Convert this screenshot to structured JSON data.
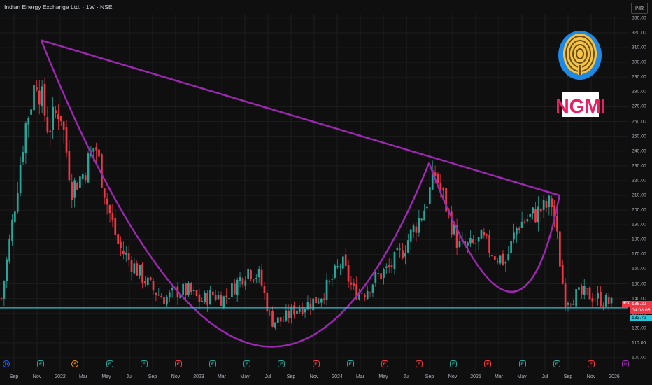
{
  "header": {
    "title": "Indian Energy Exchange Ltd. · 1W · NSE",
    "currency": "INR"
  },
  "price_labels": {
    "last_price": "136.22",
    "countdown": "04:08:05",
    "support": "133.72",
    "ticker": "IEX"
  },
  "logo": {
    "text": "NGMI"
  },
  "colors": {
    "background": "#0f0f0f",
    "up": "#26a69a",
    "down": "#f23645",
    "trendline": "#9c27b0",
    "support_line": "#26c6da"
  },
  "events": [
    {
      "type": "D",
      "x_label": "Sep"
    },
    {
      "type": "E",
      "x_label": "Nov"
    },
    {
      "type": "S",
      "x_label": "2022"
    },
    {
      "type": "E",
      "x_label": "Mar"
    },
    {
      "type": "E",
      "x_label": "May"
    },
    {
      "type": "Er",
      "x_label": "Jul"
    },
    {
      "type": "E",
      "x_label": "Sep"
    },
    {
      "type": "E",
      "x_label": "Nov"
    },
    {
      "type": "E",
      "x_label": "2023"
    },
    {
      "type": "Er",
      "x_label": "May"
    },
    {
      "type": "E",
      "x_label": "Sep"
    },
    {
      "type": "Er",
      "x_label": "2024"
    },
    {
      "type": "Er",
      "x_label": "May"
    },
    {
      "type": "E",
      "x_label": "Sep"
    },
    {
      "type": "Er",
      "x_label": "2025"
    },
    {
      "type": "E",
      "x_label": "May"
    },
    {
      "type": "E",
      "x_label": "Jul"
    },
    {
      "type": "Er",
      "x_label": "Nov"
    },
    {
      "type": "P",
      "x_label": "2026"
    }
  ],
  "chart_data": {
    "type": "candlestick",
    "title": "Indian Energy Exchange Ltd. · 1W · NSE",
    "ylabel": "INR",
    "ylim": [
      100,
      330
    ],
    "y_ticks": [
      100,
      110,
      120,
      130,
      140,
      150,
      160,
      170,
      180,
      190,
      200,
      210,
      220,
      230,
      240,
      250,
      260,
      270,
      280,
      290,
      300,
      310,
      320,
      330
    ],
    "x_ticks": [
      "Sep",
      "Nov",
      "2022",
      "Mar",
      "May",
      "Jul",
      "Sep",
      "Nov",
      "2023",
      "Mar",
      "May",
      "Jul",
      "Sep",
      "Nov",
      "2024",
      "Mar",
      "May",
      "Jul",
      "Sep",
      "Nov",
      "2025",
      "Mar",
      "May",
      "Jul",
      "Sep",
      "Nov",
      "2026"
    ],
    "close_path": [
      [
        "2021-08",
        140
      ],
      [
        "2021-09",
        195
      ],
      [
        "2021-10",
        255
      ],
      [
        "2021-11",
        290
      ],
      [
        "2021-12",
        255
      ],
      [
        "2022-01",
        270
      ],
      [
        "2022-02",
        215
      ],
      [
        "2022-03",
        225
      ],
      [
        "2022-04",
        245
      ],
      [
        "2022-05",
        205
      ],
      [
        "2022-06",
        175
      ],
      [
        "2022-07",
        165
      ],
      [
        "2022-08",
        155
      ],
      [
        "2022-09",
        145
      ],
      [
        "2022-10",
        140
      ],
      [
        "2022-11",
        145
      ],
      [
        "2022-12",
        145
      ],
      [
        "2023-01",
        138
      ],
      [
        "2023-02",
        143
      ],
      [
        "2023-03",
        140
      ],
      [
        "2023-04",
        150
      ],
      [
        "2023-05",
        160
      ],
      [
        "2023-06",
        155
      ],
      [
        "2023-07",
        125
      ],
      [
        "2023-08",
        125
      ],
      [
        "2023-09",
        133
      ],
      [
        "2023-10",
        136
      ],
      [
        "2023-11",
        140
      ],
      [
        "2023-12",
        150
      ],
      [
        "2024-01",
        165
      ],
      [
        "2024-02",
        145
      ],
      [
        "2024-03",
        145
      ],
      [
        "2024-04",
        155
      ],
      [
        "2024-05",
        160
      ],
      [
        "2024-06",
        170
      ],
      [
        "2024-07",
        185
      ],
      [
        "2024-08",
        200
      ],
      [
        "2024-09",
        225
      ],
      [
        "2024-10",
        200
      ],
      [
        "2024-11",
        175
      ],
      [
        "2024-12",
        175
      ],
      [
        "2025-01",
        180
      ],
      [
        "2025-02",
        170
      ],
      [
        "2025-03",
        165
      ],
      [
        "2025-04",
        190
      ],
      [
        "2025-05",
        195
      ],
      [
        "2025-06",
        200
      ],
      [
        "2025-07",
        205
      ],
      [
        "2025-08",
        140
      ],
      [
        "2025-09",
        142
      ],
      [
        "2025-10",
        143
      ],
      [
        "2025-11",
        140
      ],
      [
        "2025-12",
        136
      ]
    ],
    "drawings": {
      "descending_trendline": {
        "from": [
          "2021-09",
          315
        ],
        "to": [
          "2025-07",
          210
        ]
      },
      "support_line": 133.72,
      "cup_left": {
        "from": [
          "2021-09",
          315
        ],
        "bottom": [
          "2023-05",
          110
        ],
        "to": [
          "2024-09",
          232
        ]
      },
      "cup_right": {
        "from": [
          "2024-09",
          232
        ],
        "bottom": [
          "2025-03",
          145
        ],
        "to": [
          "2025-07",
          210
        ]
      }
    },
    "last_close": 136.22,
    "grid": true
  }
}
